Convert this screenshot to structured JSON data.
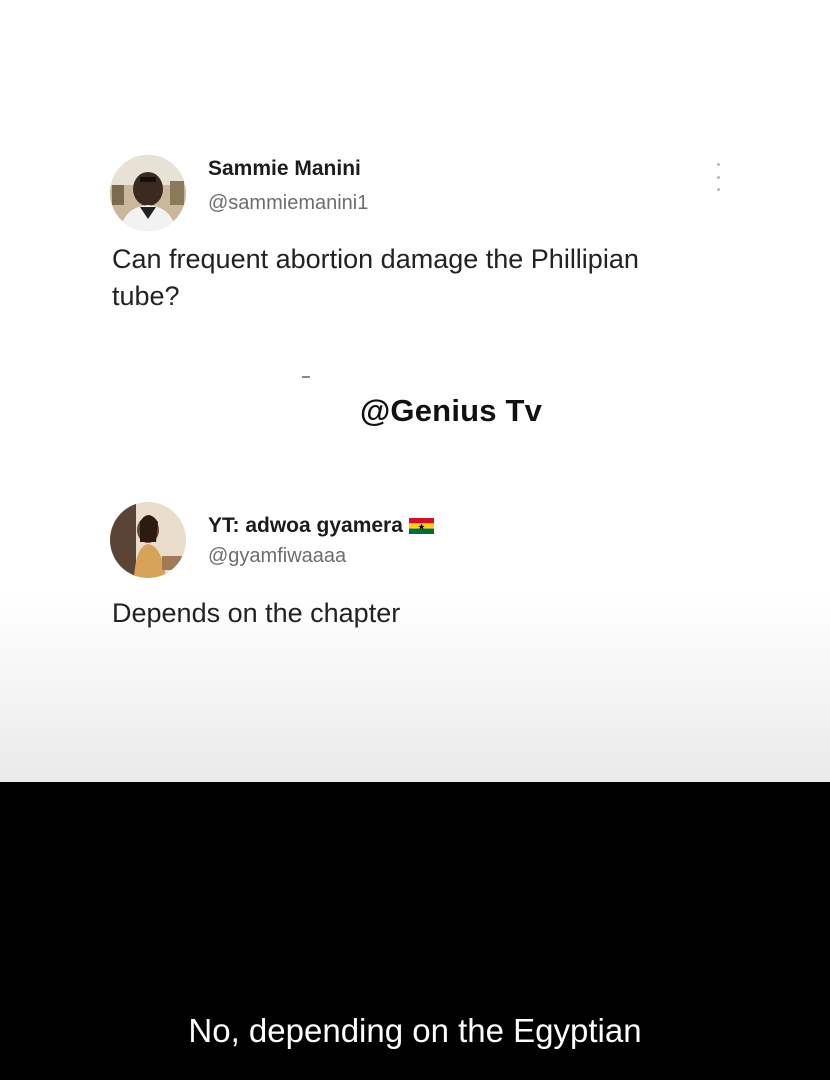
{
  "tweet1": {
    "name": "Sammie Manini",
    "handle": "@sammiemanini1",
    "text_line1": "Can frequent abortion damage the Phillipian",
    "text_line2": "tube?"
  },
  "watermark": "@Genius Tv",
  "tweet2": {
    "name": "YT: adwoa gyamera",
    "name_flag_icon": "ghana-flag-icon",
    "handle": "@gyamfiwaaaa",
    "text": "Depends on the chapter"
  },
  "caption": "No, depending on the Egyptian",
  "colors": {
    "background_top": "#ffffff",
    "background_bottom": "#000000",
    "caption_text": "#ffffff",
    "handle_text": "#6d6d6d"
  }
}
